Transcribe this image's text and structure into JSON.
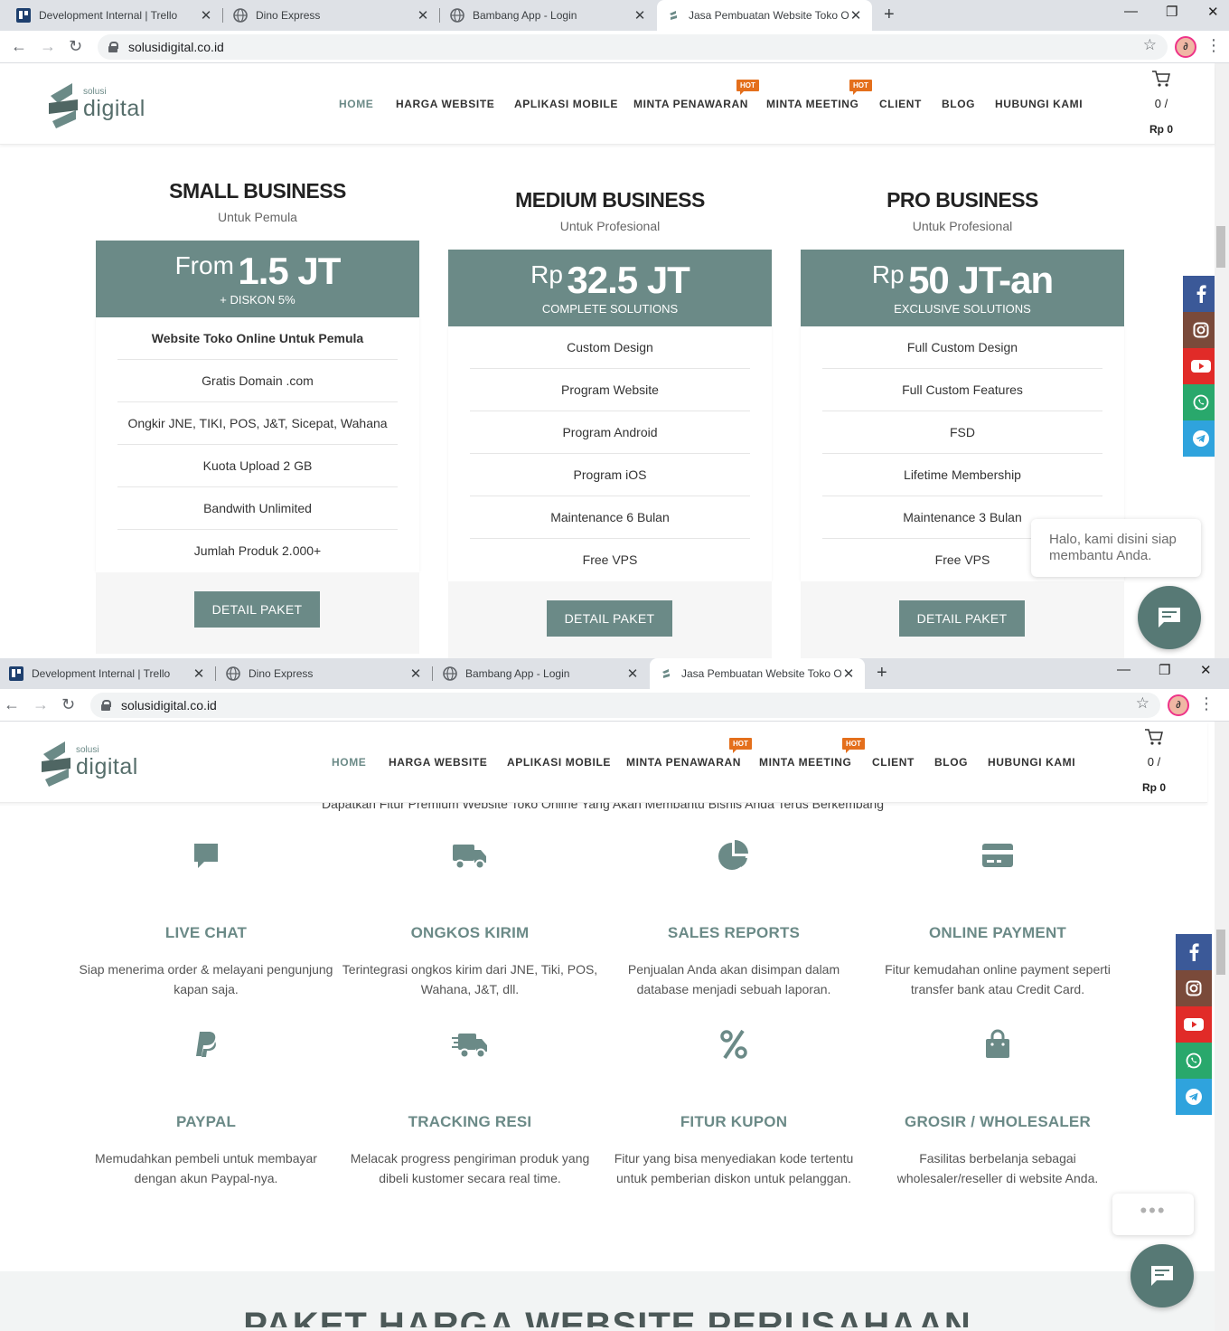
{
  "browser": {
    "tabs": [
      {
        "title": "Development Internal | Trello",
        "icon": "trello-icon"
      },
      {
        "title": "Dino Express",
        "icon": "globe-icon"
      },
      {
        "title": "Bambang App - Login",
        "icon": "globe-icon"
      },
      {
        "title": "Jasa Pembuatan Website Toko Onl",
        "icon": "site-logo-icon"
      }
    ],
    "url": "solusidigital.co.id"
  },
  "site": {
    "logo_small": "solusi",
    "logo_big": "digital",
    "menu": [
      {
        "label": "HOME"
      },
      {
        "label": "HARGA WEBSITE"
      },
      {
        "label": "APLIKASI MOBILE"
      },
      {
        "label": "MINTA PENAWARAN",
        "badge": "HOT"
      },
      {
        "label": "MINTA MEETING",
        "badge": "HOT"
      },
      {
        "label": "CLIENT"
      },
      {
        "label": "BLOG"
      },
      {
        "label": "HUBUNGI KAMI"
      }
    ],
    "cart_count": "0 /",
    "cart_total": "Rp 0"
  },
  "plans": [
    {
      "title": "SMALL BUSINESS",
      "subtitle": "Untuk Pemula",
      "prefix": "From",
      "amount": "1.5 JT",
      "note": "+ DISKON 5%",
      "features": [
        "Website Toko Online Untuk Pemula",
        "Gratis Domain .com",
        "Ongkir JNE, TIKI, POS, J&T, Sicepat, Wahana",
        "Kuota Upload 2 GB",
        "Bandwith Unlimited",
        "Jumlah Produk 2.000+"
      ],
      "button": "DETAIL PAKET"
    },
    {
      "title": "MEDIUM BUSINESS",
      "subtitle": "Untuk Profesional",
      "prefix": "Rp",
      "amount": "32.5 JT",
      "note": "COMPLETE SOLUTIONS",
      "features": [
        "Custom Design",
        "Program Website",
        "Program Android",
        "Program iOS",
        "Maintenance 6 Bulan",
        "Free VPS"
      ],
      "button": "DETAIL PAKET"
    },
    {
      "title": "PRO BUSINESS",
      "subtitle": "Untuk Profesional",
      "prefix": "Rp",
      "amount": "50 JT-an",
      "note": "EXCLUSIVE SOLUTIONS",
      "features": [
        "Full Custom Design",
        "Full Custom Features",
        "FSD",
        "Lifetime Membership",
        "Maintenance 3 Bulan",
        "Free VPS"
      ],
      "button": "DETAIL PAKET"
    }
  ],
  "chat": {
    "greeting": "Halo, kami disini siap membantu Anda.",
    "typing": "•••"
  },
  "features_intro": "Dapatkan Fitur Premium Website Toko Online Yang Akan Membantu Bisnis Anda Terus Berkembang",
  "features": [
    {
      "title": "LIVE CHAT",
      "desc": "Siap menerima order & melayani pengunjung kapan saja.",
      "icon": "chat-icon"
    },
    {
      "title": "ONGKOS KIRIM",
      "desc": "Terintegrasi ongkos kirim dari JNE, Tiki, POS, Wahana, J&T, dll.",
      "icon": "truck-icon"
    },
    {
      "title": "SALES REPORTS",
      "desc": "Penjualan Anda akan disimpan dalam database menjadi sebuah laporan.",
      "icon": "pie-chart-icon"
    },
    {
      "title": "ONLINE PAYMENT",
      "desc": "Fitur kemudahan online payment seperti transfer bank atau Credit Card.",
      "icon": "credit-card-icon"
    },
    {
      "title": "PAYPAL",
      "desc": "Memudahkan pembeli untuk membayar dengan akun Paypal-nya.",
      "icon": "paypal-icon"
    },
    {
      "title": "TRACKING RESI",
      "desc": "Melacak progress pengiriman produk yang dibeli kustomer secara real time.",
      "icon": "shipping-fast-icon"
    },
    {
      "title": "FITUR KUPON",
      "desc": "Fitur yang bisa menyediakan kode tertentu untuk pemberian diskon untuk pelanggan.",
      "icon": "percent-icon"
    },
    {
      "title": "GROSIR / WHOLESALER",
      "desc": "Fasilitas berbelanja sebagai wholesaler/reseller di website Anda.",
      "icon": "shopping-bag-icon"
    }
  ],
  "section_title": "PAKET HARGA WEBSITE PERUSAHAAN",
  "social": [
    "facebook-icon",
    "instagram-icon",
    "youtube-icon",
    "whatsapp-icon",
    "telegram-icon"
  ],
  "colors": {
    "brand": "#6b8a87",
    "hot": "#e46f1c",
    "facebook": "#3b5998",
    "instagram": "#7a4a3a",
    "youtube": "#e12b28",
    "whatsapp": "#29a86c",
    "telegram": "#2fa3dd"
  }
}
